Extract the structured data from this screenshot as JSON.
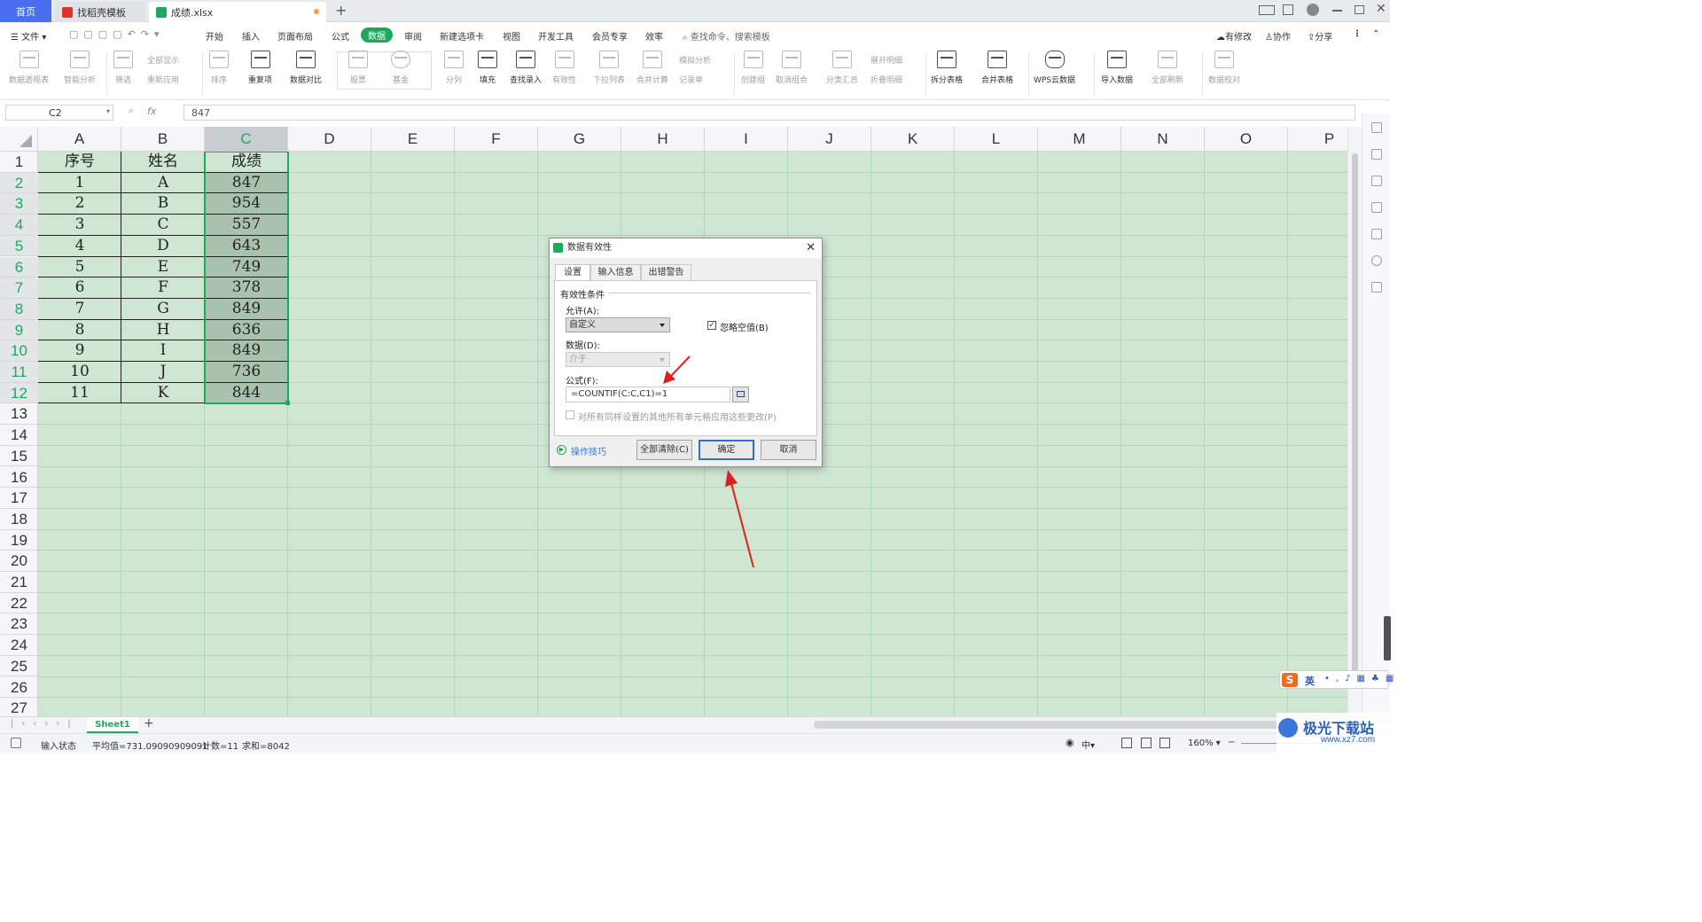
{
  "tabs": {
    "home": "首页",
    "templates": "找稻壳模板",
    "file": "成绩.xlsx",
    "new_tab": "+"
  },
  "menu": {
    "file": "文件",
    "items": [
      "开始",
      "插入",
      "页面布局",
      "公式",
      "数据",
      "审阅",
      "新建选项卡",
      "视图",
      "开发工具",
      "会员专享",
      "效率"
    ],
    "active": "数据",
    "search": "查找命令、搜索模板",
    "right": [
      "有修改",
      "协作",
      "分享"
    ]
  },
  "ribbon": {
    "buttons": [
      "数据透视表",
      "智能分析",
      "筛选",
      "排序",
      "重复项",
      "数据对比",
      "股票",
      "基金",
      "分列",
      "填充",
      "查找录入",
      "有效性",
      "下拉列表",
      "合并计算",
      "创建组",
      "取消组合",
      "分类汇总",
      "拆分表格",
      "合并表格",
      "WPS云数据",
      "导入数据",
      "全部刷新",
      "数据校对"
    ],
    "small": [
      "全部显示",
      "重新应用",
      "模拟分析",
      "记录单",
      "展开明细",
      "折叠明细"
    ]
  },
  "formula_bar": {
    "cell_ref": "C2",
    "fx": "fx",
    "value": "847"
  },
  "columns": [
    "A",
    "B",
    "C",
    "D",
    "E",
    "F",
    "G",
    "H",
    "I",
    "J",
    "K",
    "L",
    "M",
    "N",
    "O",
    "P"
  ],
  "rows": [
    "1",
    "2",
    "3",
    "4",
    "5",
    "6",
    "7",
    "8",
    "9",
    "10",
    "11",
    "12",
    "13",
    "14",
    "15",
    "16",
    "17",
    "18",
    "19",
    "20",
    "21",
    "22",
    "23",
    "24",
    "25",
    "26",
    "27"
  ],
  "table": {
    "headers": [
      "序号",
      "姓名",
      "成绩"
    ],
    "rows": [
      [
        "1",
        "A",
        "847"
      ],
      [
        "2",
        "B",
        "954"
      ],
      [
        "3",
        "C",
        "557"
      ],
      [
        "4",
        "D",
        "643"
      ],
      [
        "5",
        "E",
        "749"
      ],
      [
        "6",
        "F",
        "378"
      ],
      [
        "7",
        "G",
        "849"
      ],
      [
        "8",
        "H",
        "636"
      ],
      [
        "9",
        "I",
        "849"
      ],
      [
        "10",
        "J",
        "736"
      ],
      [
        "11",
        "K",
        "844"
      ]
    ]
  },
  "dialog": {
    "title": "数据有效性",
    "tabs": [
      "设置",
      "输入信息",
      "出错警告"
    ],
    "section": "有效性条件",
    "allow_label": "允许(A):",
    "allow_value": "自定义",
    "ignore_blank": "忽略空值(B)",
    "data_label": "数据(D):",
    "data_value": "介于",
    "formula_label": "公式(F):",
    "formula_value": "=COUNTIF(C:C,C1)=1",
    "apply_all": "对所有同样设置的其他所有单元格应用这些更改(P)",
    "tips": "操作技巧",
    "clear_all": "全部清除(C)",
    "ok": "确定",
    "cancel": "取消"
  },
  "sheet": {
    "name": "Sheet1"
  },
  "status": {
    "mode": "输入状态",
    "avg": "平均值=731.09090909091",
    "count": "计数=11",
    "sum": "求和=8042",
    "zoom": "160%",
    "ime": "中"
  },
  "watermark": "极光下载站",
  "watermark_url": "www.xz7.com",
  "ime_label": "英",
  "colors": {
    "accent": "#1fa85c",
    "selection_bg": "#cfe6d2",
    "tab_blue": "#4a6ef0",
    "arrow": "#e02020"
  }
}
